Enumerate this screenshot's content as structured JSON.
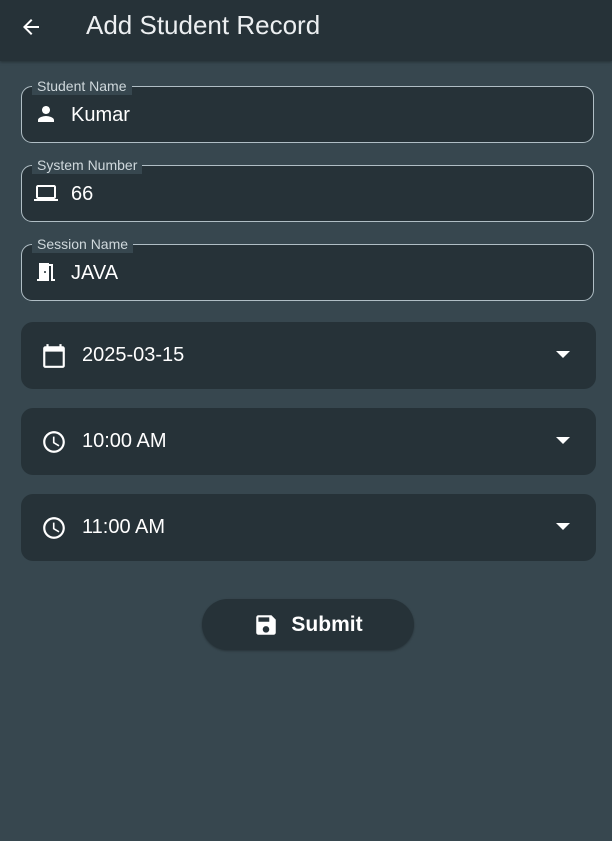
{
  "appbar": {
    "title": "Add Student Record",
    "back_icon": "arrow-back-icon"
  },
  "form": {
    "student_name": {
      "label": "Student Name",
      "value": "Kumar",
      "icon": "person-icon"
    },
    "system_number": {
      "label": "System Number",
      "value": "66",
      "icon": "laptop-icon"
    },
    "session_name": {
      "label": "Session Name",
      "value": "JAVA",
      "icon": "door-icon"
    },
    "date": {
      "value": "2025-03-15",
      "icon": "calendar-icon"
    },
    "start_time": {
      "value": "10:00 AM",
      "icon": "clock-icon"
    },
    "end_time": {
      "value": "11:00 AM",
      "icon": "clock-icon"
    }
  },
  "submit": {
    "label": "Submit",
    "icon": "save-icon"
  },
  "colors": {
    "background": "#37474f",
    "surface": "#263238",
    "outline": "#b0bec5",
    "text": "#ffffff"
  }
}
